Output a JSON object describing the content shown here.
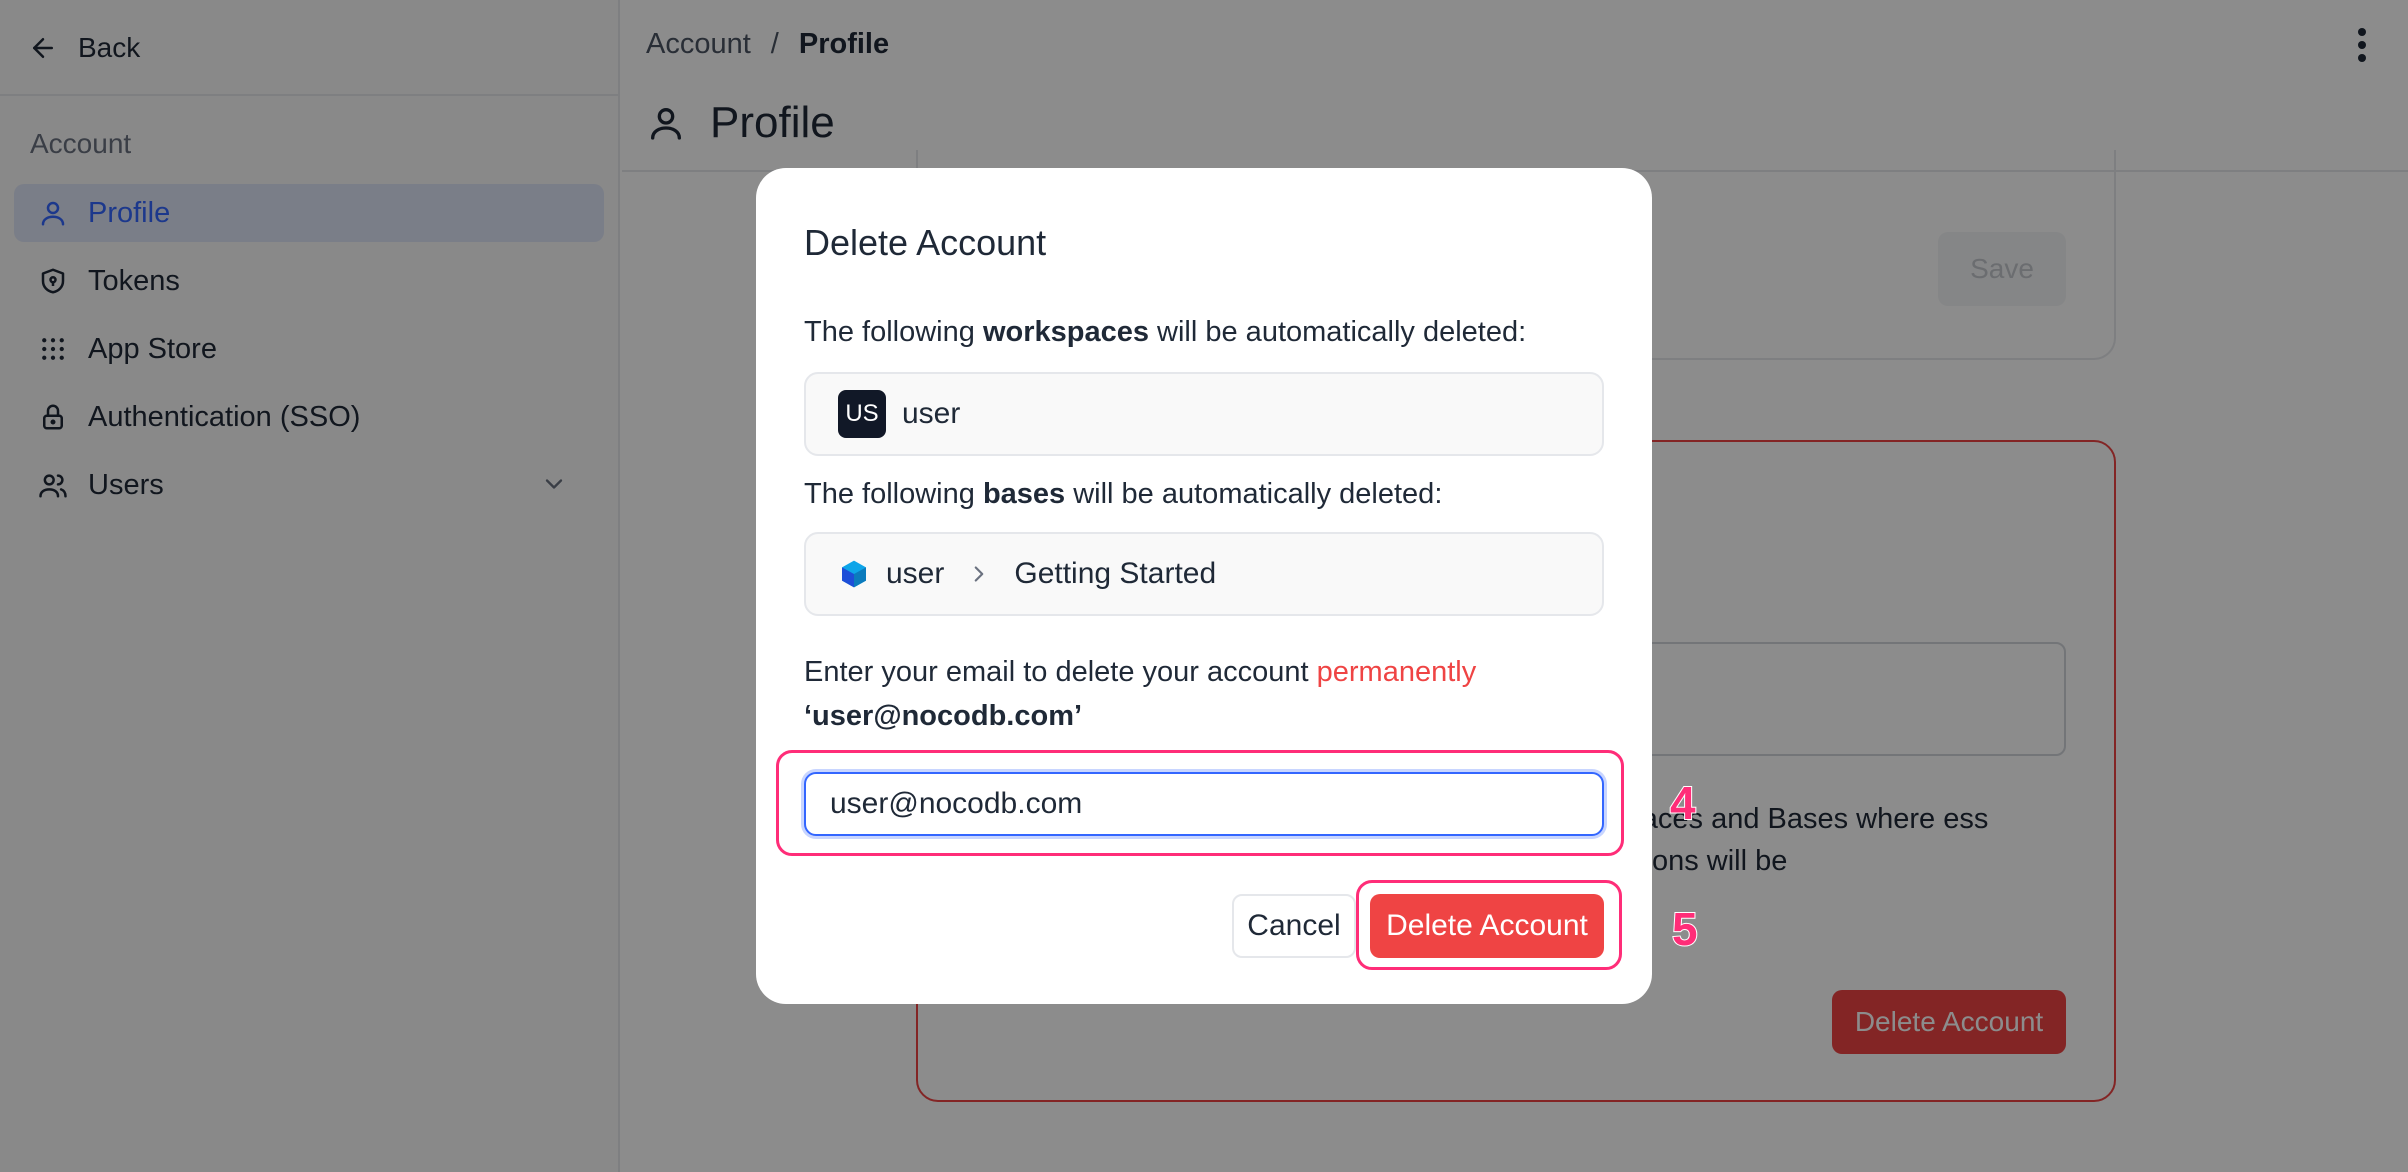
{
  "sidebar": {
    "back_label": "Back",
    "section_title": "Account",
    "items": [
      {
        "label": "Profile",
        "icon": "user-icon",
        "active": true
      },
      {
        "label": "Tokens",
        "icon": "shield-icon"
      },
      {
        "label": "App Store",
        "icon": "grid-icon"
      },
      {
        "label": "Authentication (SSO)",
        "icon": "lock-icon"
      },
      {
        "label": "Users",
        "icon": "users-icon",
        "expandable": true
      }
    ]
  },
  "header": {
    "breadcrumb": [
      "Account",
      "Profile"
    ],
    "breadcrumb_separator": "/",
    "title": "Profile"
  },
  "background": {
    "save_label": "Save",
    "danger_note": "Workspaces and Bases where ess permissions will be",
    "delete_label": "Delete Account"
  },
  "modal": {
    "title": "Delete Account",
    "workspaces_prefix": "The following ",
    "workspaces_bold": "workspaces",
    "workspaces_suffix": " will be automatically deleted:",
    "workspace": {
      "avatar": "US",
      "name": "user"
    },
    "bases_prefix": "The following ",
    "bases_bold": "bases",
    "bases_suffix": " will be automatically deleted:",
    "base": {
      "workspace": "user",
      "name": "Getting Started"
    },
    "confirm_prefix": "Enter your email to delete your account ",
    "confirm_emphasis": "permanently",
    "confirm_email": "‘user@nocodb.com’",
    "email_value": "user@nocodb.com",
    "cancel_label": "Cancel",
    "delete_label": "Delete Account"
  },
  "annotations": {
    "step_input": "4",
    "step_button": "5"
  },
  "colors": {
    "accent": "#3366ff",
    "danger": "#ef4444",
    "annotation": "#ff2d78"
  }
}
